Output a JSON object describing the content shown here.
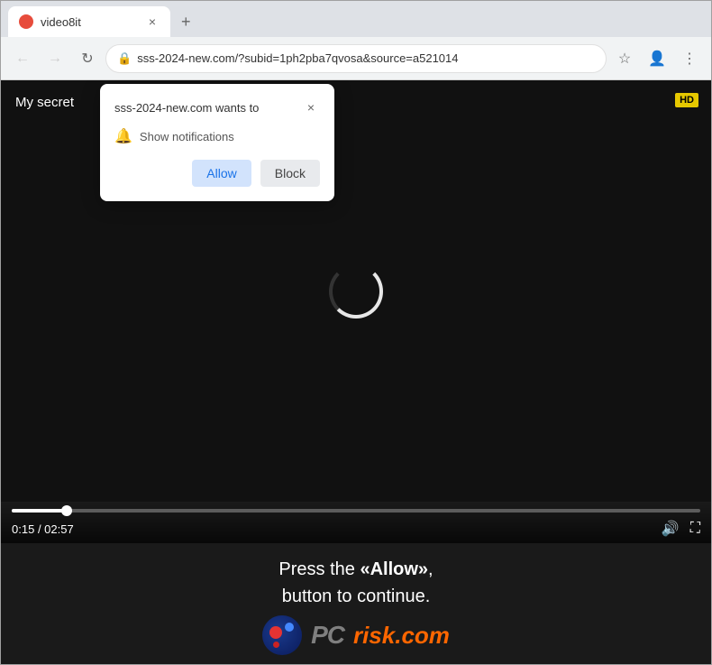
{
  "browser": {
    "tab": {
      "title": "video8it",
      "favicon_color": "#e74c3c"
    },
    "new_tab_label": "+",
    "address_bar": {
      "url": "sss-2024-new.com/?subid=1ph2pba7qvosa&source=a521014",
      "lock_icon": "🔒"
    },
    "nav_buttons": {
      "back": "←",
      "forward": "→",
      "refresh": "↻",
      "bookmark": "☆",
      "profile": "👤",
      "menu": "⋮"
    }
  },
  "notification_popup": {
    "title": "sss-2024-new.com wants to",
    "close_icon": "×",
    "bell_icon": "🔔",
    "notification_text": "Show notifications",
    "allow_label": "Allow",
    "block_label": "Block"
  },
  "video": {
    "title": "My secret",
    "hd_badge": "HD",
    "time_current": "0:15",
    "time_total": "02:57",
    "progress_percent": 8,
    "volume_icon": "🔊",
    "fullscreen_icon": "⛶"
  },
  "banner": {
    "line1": "Press the ",
    "highlight": "«Allow»",
    "line1_end": ",",
    "line2": "button to continue.",
    "logo_text_pc": "PC",
    "logo_text_risk": "risk.com"
  }
}
